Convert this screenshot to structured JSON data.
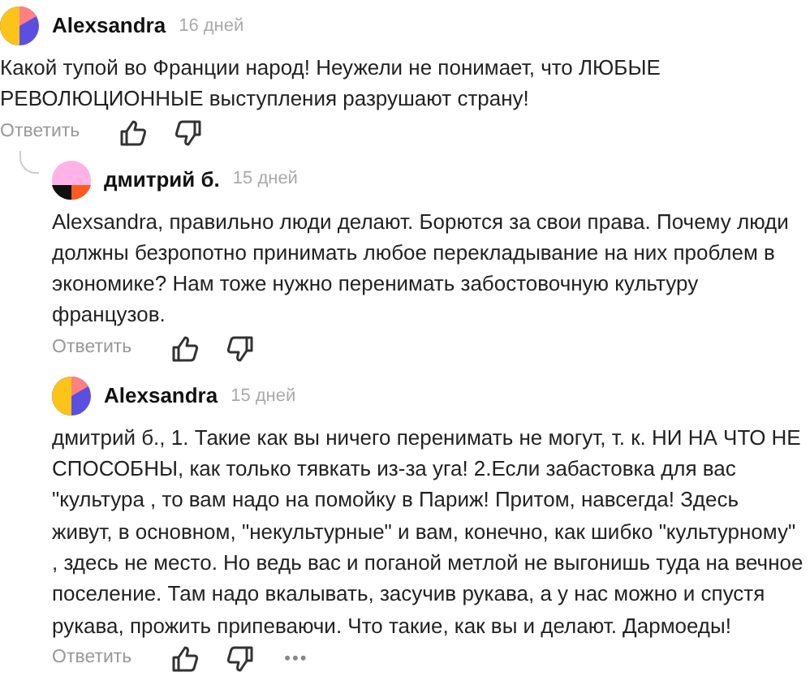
{
  "comments": [
    {
      "author": "Alexsandra",
      "time": "16 дней",
      "indented": false,
      "thread_line": false,
      "avatar": {
        "kind": "split"
      },
      "text": "Какой тупой во Франции народ! Неужели не понимает, что ЛЮБЫЕ РЕВОЛЮЦИОННЫЕ выступления разрушают страну!",
      "reply_label": "Ответить"
    },
    {
      "author": "дмитрий б.",
      "time": "15 дней",
      "indented": true,
      "thread_line": true,
      "avatar": {
        "kind": "banded"
      },
      "text": "Alexsandra, правильно люди делают. Борются за свои права. Почему люди должны безропотно принимать любое перекладывание на них проблем в экономике? Нам тоже нужно перенимать забостовочную культуру французов.",
      "reply_label": "Ответить"
    },
    {
      "author": "Alexsandra",
      "time": "15 дней",
      "indented": true,
      "thread_line": false,
      "avatar": {
        "kind": "split"
      },
      "text": "дмитрий б., 1. Такие как вы ничего перенимать не могут, т. к. НИ НА ЧТО НЕ СПОСОБНЫ, как только тявкать из-за уга! 2.Если забастовка для вас \"культура , то вам надо на помойку в Париж! Притом, навсегда! Здесь живут, в основном, \"некультурные\" и вам, конечно, как шибко \"культурному\" , здесь не место. Но ведь вас и поганой метлой не выгонишь туда на вечное поселение. Там надо вкалывать, засучив рукава, а у нас можно и спустя рукава, прожить припеваючи. Что такие, как вы и делают. Дармоеды!",
      "reply_label": "Ответить",
      "more": "•••"
    }
  ]
}
